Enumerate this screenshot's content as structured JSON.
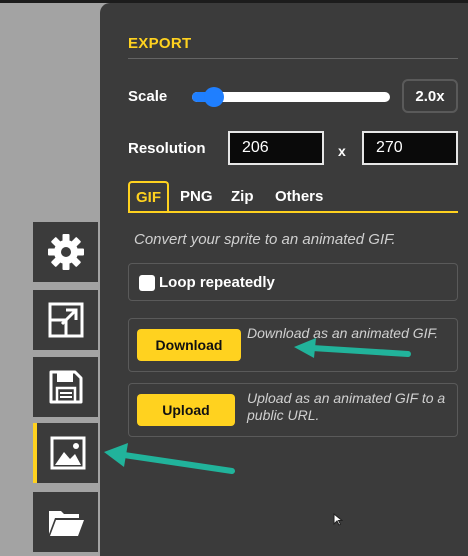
{
  "export": {
    "title": "EXPORT",
    "scale_label": "Scale",
    "scale_value": "2.0x",
    "scale_fraction": 0.07,
    "resolution_label": "Resolution",
    "width": "206",
    "height": "270",
    "times": "x"
  },
  "tabs": [
    {
      "label": "GIF",
      "active": true
    },
    {
      "label": "PNG",
      "active": false
    },
    {
      "label": "Zip",
      "active": false
    },
    {
      "label": "Others",
      "active": false
    }
  ],
  "gif": {
    "description": "Convert your sprite to an animated GIF.",
    "loop_label": "Loop repeatedly",
    "loop_checked": false,
    "download_label": "Download",
    "download_desc": "Download as an animated GIF.",
    "upload_label": "Upload",
    "upload_desc": "Upload as an animated GIF to a public URL."
  },
  "toolbar": [
    {
      "icon": "gear-icon"
    },
    {
      "icon": "resize-icon"
    },
    {
      "icon": "save-icon"
    },
    {
      "icon": "image-icon",
      "active": true
    },
    {
      "icon": "folder-icon"
    }
  ],
  "colors": {
    "accent": "#ffd21f",
    "panel": "#3b3b3b",
    "slider": "#1f7fff",
    "annotation": "#21b39b"
  }
}
